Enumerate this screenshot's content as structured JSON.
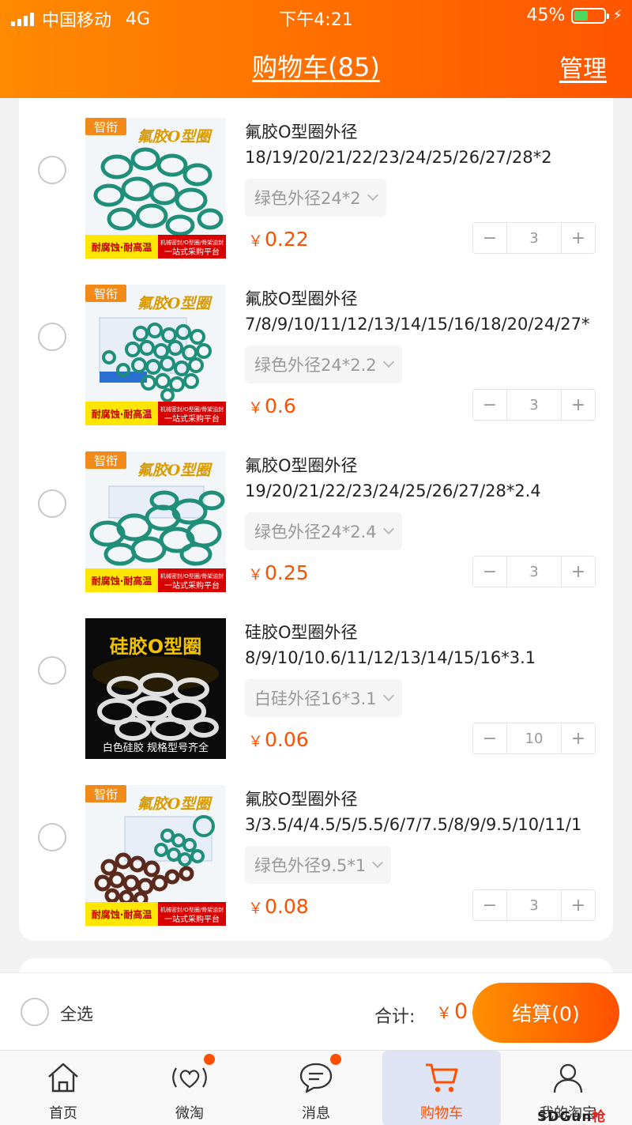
{
  "status_bar": {
    "carrier": "中国移动",
    "network": "4G",
    "time": "下午4:21",
    "battery": "45%",
    "battery_level": 0.45
  },
  "header": {
    "title": "购物车(85)",
    "manage": "管理"
  },
  "cart_items": [
    {
      "title_line1": "氟胶O型圈外径",
      "title_line2": "18/19/20/21/22/23/24/25/26/27/28*2",
      "sku": "绿色外径24*2",
      "currency": "￥",
      "price": "0.22",
      "qty": "3",
      "image_label": "智衔",
      "image_heading": "氟胶O型圈",
      "image_footer_left": "耐腐蚀·耐高温",
      "image_footer_right_1": "机械密封/O型圈/骨架油封",
      "image_footer_right_2": "一站式采购平台"
    },
    {
      "title_line1": "氟胶O型圈外径",
      "title_line2": "7/8/9/10/11/12/13/14/15/16/18/20/24/27*",
      "sku": "绿色外径24*2.2",
      "currency": "￥",
      "price": "0.6",
      "qty": "3",
      "image_label": "智衔",
      "image_heading": "氟胶O型圈",
      "image_footer_left": "耐腐蚀·耐高温",
      "image_footer_right_1": "机械密封/O型圈/骨架油封",
      "image_footer_right_2": "一站式采购平台"
    },
    {
      "title_line1": "氟胶O型圈外径",
      "title_line2": "19/20/21/22/23/24/25/26/27/28*2.4",
      "sku": "绿色外径24*2.4",
      "currency": "￥",
      "price": "0.25",
      "qty": "3",
      "image_label": "智衔",
      "image_heading": "氟胶O型圈",
      "image_footer_left": "耐腐蚀·耐高温",
      "image_footer_right_1": "机械密封/O型圈/骨架油封",
      "image_footer_right_2": "一站式采购平台"
    },
    {
      "title_line1": "硅胶O型圈外径",
      "title_line2": "8/9/10/10.6/11/12/13/14/15/16*3.1",
      "sku": "白硅外径16*3.1",
      "currency": "￥",
      "price": "0.06",
      "qty": "10",
      "image_heading": "硅胶O型圈",
      "image_footer": "白色硅胶 规格型号齐全"
    },
    {
      "title_line1": "氟胶O型圈外径",
      "title_line2": "3/3.5/4/4.5/5/5.5/6/7/7.5/8/9/9.5/10/11/1",
      "sku": "绿色外径9.5*1",
      "currency": "￥",
      "price": "0.08",
      "qty": "3",
      "image_label": "智衔",
      "image_heading": "氟胶O型圈",
      "image_footer_left": "耐腐蚀·耐高温",
      "image_footer_right_1": "机械密封/O型圈/骨架油封",
      "image_footer_right_2": "一站式采购平台"
    }
  ],
  "stepper": {
    "minus": "−",
    "plus": "+"
  },
  "footer": {
    "select_all": "全选",
    "total_label": "合计:",
    "currency": "￥",
    "total": "0",
    "checkout": "结算(0)"
  },
  "tabs": [
    {
      "label": "首页",
      "icon": "home-icon"
    },
    {
      "label": "微淘",
      "icon": "heart-broadcast-icon"
    },
    {
      "label": "消息",
      "icon": "chat-bubble-icon"
    },
    {
      "label": "购物车",
      "icon": "cart-icon"
    },
    {
      "label": "我的淘宝",
      "icon": "user-icon"
    }
  ],
  "colors": {
    "brand_orange": "#ff5000",
    "header_gradient_start": "#ff8a00",
    "fluoro_ring_green": "#1f8f7a",
    "silicone_ring_white": "#f2f2f2",
    "brown_ring": "#5b2a1c"
  },
  "watermark": {
    "part1": "SDGun",
    "part2": "枪"
  }
}
